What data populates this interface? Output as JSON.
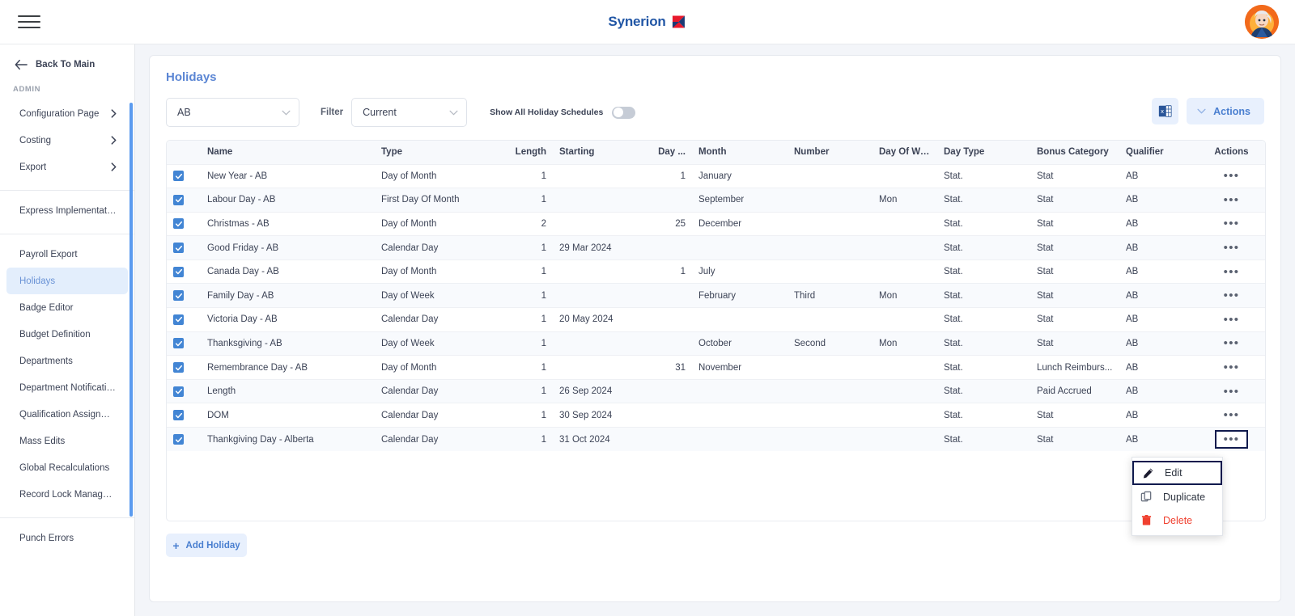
{
  "topbar": {
    "menu_icon": "hamburger-icon",
    "brand": "Synerion",
    "brand_color": "#2156a5",
    "avatar_alt": "user-avatar"
  },
  "sidebar": {
    "back_label": "Back To Main",
    "section_label": "ADMIN",
    "groups": [
      {
        "items": [
          {
            "label": "Configuration Page",
            "expandable": true
          },
          {
            "label": "Costing",
            "expandable": true
          },
          {
            "label": "Export",
            "expandable": true
          }
        ]
      },
      {
        "items": [
          {
            "label": "Express Implementation P...",
            "expandable": false
          }
        ]
      },
      {
        "items": [
          {
            "label": "Payroll Export",
            "expandable": false
          },
          {
            "label": "Holidays",
            "expandable": false,
            "active": true
          },
          {
            "label": "Badge Editor",
            "expandable": false
          },
          {
            "label": "Budget Definition",
            "expandable": false
          },
          {
            "label": "Departments",
            "expandable": false
          },
          {
            "label": "Department Notifications",
            "expandable": false
          },
          {
            "label": "Qualification Assignments",
            "expandable": false
          },
          {
            "label": "Mass Edits",
            "expandable": false
          },
          {
            "label": "Global Recalculations",
            "expandable": false
          },
          {
            "label": "Record Lock Management",
            "expandable": false
          }
        ]
      },
      {
        "items": [
          {
            "label": "Punch Errors",
            "expandable": false
          }
        ]
      }
    ]
  },
  "page": {
    "title": "Holidays",
    "accent_color": "#5b86d4"
  },
  "toolbar": {
    "schedule_select": "AB",
    "filter_label": "Filter",
    "filter_select": "Current",
    "toggle_label": "Show All Holiday Schedules",
    "toggle_on": false,
    "export_icon": "excel-export-icon",
    "actions_label": "Actions"
  },
  "table": {
    "columns": [
      "",
      "Name",
      "Type",
      "Length",
      "Starting",
      "Day ...",
      "Month",
      "Number",
      "Day Of We...",
      "Day Type",
      "Bonus Category",
      "Qualifier",
      "Actions"
    ],
    "rows": [
      {
        "checked": true,
        "name": "New Year - AB",
        "type": "Day of Month",
        "length": "1",
        "starting": "",
        "day": "1",
        "month": "January",
        "number": "",
        "dow": "",
        "day_type": "Stat.",
        "bonus": "Stat",
        "qualifier": "AB"
      },
      {
        "checked": true,
        "name": "Labour Day - AB",
        "type": "First Day Of Month",
        "length": "1",
        "starting": "",
        "day": "",
        "month": "September",
        "number": "",
        "dow": "Mon",
        "day_type": "Stat.",
        "bonus": "Stat",
        "qualifier": "AB"
      },
      {
        "checked": true,
        "name": "Christmas - AB",
        "type": "Day of Month",
        "length": "2",
        "starting": "",
        "day": "25",
        "month": "December",
        "number": "",
        "dow": "",
        "day_type": "Stat.",
        "bonus": "Stat",
        "qualifier": "AB"
      },
      {
        "checked": true,
        "name": "Good Friday - AB",
        "type": "Calendar Day",
        "length": "1",
        "starting": "29 Mar 2024",
        "day": "",
        "month": "",
        "number": "",
        "dow": "",
        "day_type": "Stat.",
        "bonus": "Stat",
        "qualifier": "AB"
      },
      {
        "checked": true,
        "name": "Canada Day - AB",
        "type": "Day of Month",
        "length": "1",
        "starting": "",
        "day": "1",
        "month": "July",
        "number": "",
        "dow": "",
        "day_type": "Stat.",
        "bonus": "Stat",
        "qualifier": "AB"
      },
      {
        "checked": true,
        "name": "Family Day - AB",
        "type": "Day of Week",
        "length": "1",
        "starting": "",
        "day": "",
        "month": "February",
        "number": "Third",
        "dow": "Mon",
        "day_type": "Stat.",
        "bonus": "Stat",
        "qualifier": "AB"
      },
      {
        "checked": true,
        "name": "Victoria Day - AB",
        "type": "Calendar Day",
        "length": "1",
        "starting": "20 May 2024",
        "day": "",
        "month": "",
        "number": "",
        "dow": "",
        "day_type": "Stat.",
        "bonus": "Stat",
        "qualifier": "AB"
      },
      {
        "checked": true,
        "name": "Thanksgiving - AB",
        "type": "Day of Week",
        "length": "1",
        "starting": "",
        "day": "",
        "month": "October",
        "number": "Second",
        "dow": "Mon",
        "day_type": "Stat.",
        "bonus": "Stat",
        "qualifier": "AB"
      },
      {
        "checked": true,
        "name": "Remembrance Day - AB",
        "type": "Day of Month",
        "length": "1",
        "starting": "",
        "day": "31",
        "month": "November",
        "number": "",
        "dow": "",
        "day_type": "Stat.",
        "bonus": "Lunch Reimburs...",
        "qualifier": "AB"
      },
      {
        "checked": true,
        "name": "Length",
        "type": "Calendar Day",
        "length": "1",
        "starting": "26 Sep 2024",
        "day": "",
        "month": "",
        "number": "",
        "dow": "",
        "day_type": "Stat.",
        "bonus": "Paid Accrued",
        "qualifier": "AB"
      },
      {
        "checked": true,
        "name": "DOM",
        "type": "Calendar Day",
        "length": "1",
        "starting": "30 Sep 2024",
        "day": "",
        "month": "",
        "number": "",
        "dow": "",
        "day_type": "Stat.",
        "bonus": "Stat",
        "qualifier": "AB"
      },
      {
        "checked": true,
        "name": "Thankgiving Day - Alberta",
        "type": "Calendar Day",
        "length": "1",
        "starting": "31 Oct 2024",
        "day": "",
        "month": "",
        "number": "",
        "dow": "",
        "day_type": "Stat.",
        "bonus": "Stat",
        "qualifier": "AB",
        "menu_open": true
      }
    ]
  },
  "context_menu": {
    "items": [
      {
        "label": "Edit",
        "icon": "pencil-icon",
        "focused": true
      },
      {
        "label": "Duplicate",
        "icon": "copy-icon",
        "focused": false
      },
      {
        "label": "Delete",
        "icon": "trash-icon",
        "focused": false,
        "danger": true
      }
    ],
    "danger_color": "#f0402f",
    "focus_outline_color": "#101a4d"
  },
  "footer": {
    "add_label": "Add Holiday"
  }
}
